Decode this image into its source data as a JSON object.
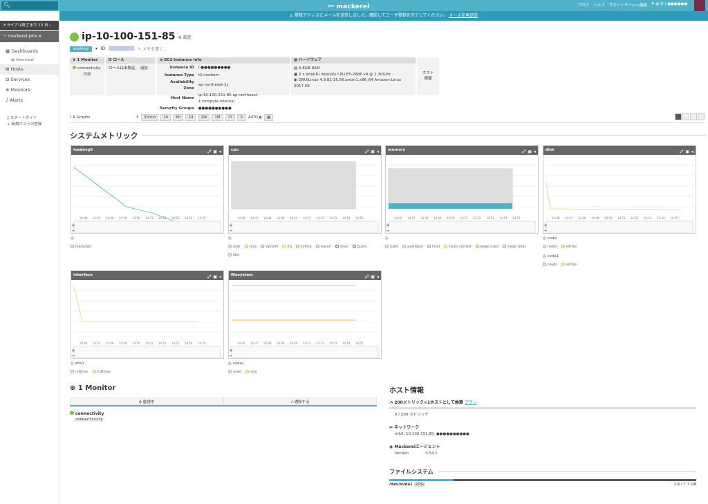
{
  "topbar": {
    "search_placeholder": "",
    "logo": "mackerel",
    "links": [
      "ブログ",
      "ヘルプ",
      "サポートチームへ連絡",
      "⚑ ◉ ☰ | ●●●●●●"
    ]
  },
  "notice": {
    "text": "⚠ 登録アドレスにメールを送信しました。確認してユーザ登録を完了してください。",
    "link": "メールを再送信"
  },
  "sidebar": {
    "trial": "トライアル終了まで 13 日",
    "org": "mackerel-john",
    "items": [
      {
        "label": "Dashboards"
      },
      {
        "label": "Overview"
      },
      {
        "label": "Hosts"
      },
      {
        "label": "Services"
      },
      {
        "label": "Monitors"
      },
      {
        "label": "Alerts"
      }
    ],
    "extra": [
      "スタートガイド",
      "新規ホストの登録"
    ]
  },
  "host": {
    "name": "ip-10-100-151-85",
    "settings": "設定",
    "status": "working",
    "id_label": "ID",
    "memo": "メモを書く...",
    "monitor_box": {
      "title": "1 Monitor",
      "item": "connectivity",
      "link": "詳細"
    },
    "role_box": {
      "title": "ロール",
      "text": "ロールは未設定。",
      "add": "追加"
    },
    "ec2_box": {
      "title": "EC2 Instance Info",
      "rows": [
        {
          "k": "Instance ID",
          "v": "i-●●●●●●●●●"
        },
        {
          "k": "Instance Type",
          "v": "t2.medium"
        },
        {
          "k": "Availability Zone",
          "v": "ap-northeast-1c"
        },
        {
          "k": "Host Name",
          "v": "ip-10-100-151-85.ap-northeast-1.compute.internal"
        },
        {
          "k": "Security Groups",
          "v": "●●●●●●●●●●"
        }
      ]
    },
    "hw_box": {
      "title": "ハードウェア",
      "lines": [
        "3.8GB RAM",
        "2 x Intel(R) Xeon(R) CPU E5-2686 v4 @ 2.30GHz",
        "GNU/Linux 4.9.81-35.56.amzn1.x86_64 Amazon Linux 2017.09"
      ]
    },
    "host_info_btn": "ホスト\n情報"
  },
  "toolbar": {
    "graphs": "6 Graphs",
    "ranges": [
      "30min",
      "1h",
      "6h",
      "1d",
      "1W",
      "1M",
      "1Y"
    ],
    "auto": "AUTO"
  },
  "system_metrics_title": "システムメトリック",
  "time_ticks": [
    "14:46",
    "14:47",
    "14:48",
    "14:49",
    "14:50",
    "14:51",
    "14:52",
    "14:53",
    "14:54",
    "14:55"
  ],
  "graphs": [
    {
      "title": "loadavg5",
      "legend": [
        {
          "label": "loadavg5",
          "color": "#4fb2c9"
        }
      ]
    },
    {
      "title": "cpu",
      "legend": [
        {
          "label": "user",
          "color": "#4fb2c9"
        },
        {
          "label": "nice",
          "color": "#e9a13b"
        },
        {
          "label": "system",
          "color": "#b06ad3"
        },
        {
          "label": "irq",
          "color": "#e9b73b"
        },
        {
          "label": "softirq",
          "color": "#e67e22"
        },
        {
          "label": "iowait",
          "color": "#4fb28a"
        },
        {
          "label": "steal",
          "color": "#555"
        },
        {
          "label": "guest",
          "color": "#2c5aa0"
        },
        {
          "label": "idle",
          "color": "#999"
        }
      ]
    },
    {
      "title": "memory",
      "legend": [
        {
          "label": "used",
          "color": "#4fb2c9"
        },
        {
          "label": "available",
          "color": "#999"
        },
        {
          "label": "total",
          "color": "#b06ad3"
        },
        {
          "label": "swap cached",
          "color": "#b0c23b"
        },
        {
          "label": "swap used",
          "color": "#e67e22"
        },
        {
          "label": "swap total",
          "color": "#4fb28a"
        }
      ]
    },
    {
      "title": "disk",
      "devices": [
        "xvda",
        "xvda1"
      ],
      "legend": [
        {
          "label": "reads",
          "color": "#4fb2c9"
        },
        {
          "label": "writes",
          "color": "#e9a13b"
        },
        {
          "label": "reads",
          "color": "#b06ad3"
        },
        {
          "label": "writes",
          "color": "#b0c23b"
        }
      ]
    },
    {
      "title": "interface",
      "devices": [
        "eth0"
      ],
      "legend": [
        {
          "label": "rxBytes",
          "color": "#4fb2c9"
        },
        {
          "label": "txBytes",
          "color": "#e9a13b"
        }
      ]
    },
    {
      "title": "filesystem",
      "devices": [
        "xvda1"
      ],
      "legend": [
        {
          "label": "used",
          "color": "#4fb2c9"
        },
        {
          "label": "size",
          "color": "#e9a13b"
        }
      ]
    }
  ],
  "monitor": {
    "title": "1 Monitor",
    "tab_active": "監視中",
    "tab_notify": "通知する",
    "item": "connectivity",
    "code": "connectivity"
  },
  "host_info": {
    "title": "ホスト情報",
    "metric_title": "200メトリック×1ホストとして換算",
    "plan_link": "プラン",
    "metric_usage": "0 / 200 メトリック",
    "network_title": "ネットワーク",
    "network_value": "eth0: 10.100.151.85, ●●●●●●●●●●",
    "agent_title": "Mackerelエージェント",
    "version_label": "Version",
    "version_value": "0.54.1"
  },
  "filesystem": {
    "title": "ファイルシステム",
    "device": "/dev/xvda1",
    "percent": "21%",
    "usage": "1.6 / 7.7 GB",
    "usage_fraction": 0.21
  }
}
